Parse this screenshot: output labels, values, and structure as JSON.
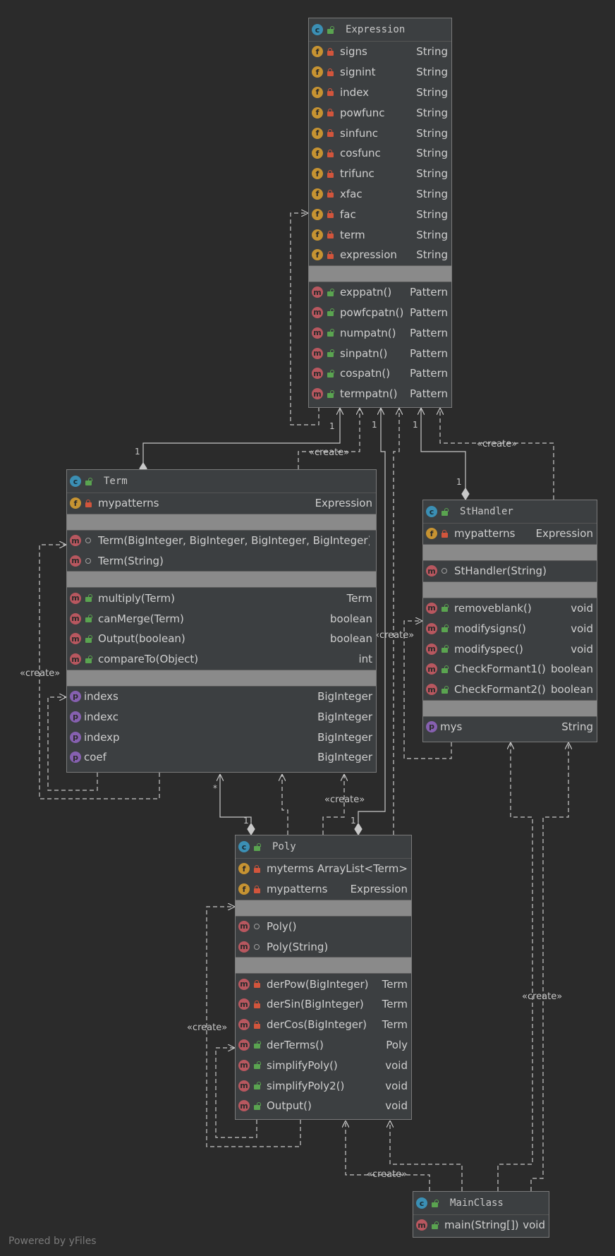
{
  "stereotype_create": "«create»",
  "footer": "Powered by yFiles",
  "multiplicity": {
    "one": "1",
    "many": "*"
  },
  "classes": {
    "expression": {
      "name": "Expression",
      "fields": [
        {
          "name": "signs",
          "type": "String"
        },
        {
          "name": "signint",
          "type": "String"
        },
        {
          "name": "index",
          "type": "String"
        },
        {
          "name": "powfunc",
          "type": "String"
        },
        {
          "name": "sinfunc",
          "type": "String"
        },
        {
          "name": "cosfunc",
          "type": "String"
        },
        {
          "name": "trifunc",
          "type": "String"
        },
        {
          "name": "xfac",
          "type": "String"
        },
        {
          "name": "fac",
          "type": "String"
        },
        {
          "name": "term",
          "type": "String"
        },
        {
          "name": "expression",
          "type": "String"
        }
      ],
      "methods": [
        {
          "name": "exppatn()",
          "type": "Pattern"
        },
        {
          "name": "powfcpatn()",
          "type": "Pattern"
        },
        {
          "name": "numpatn()",
          "type": "Pattern"
        },
        {
          "name": "sinpatn()",
          "type": "Pattern"
        },
        {
          "name": "cospatn()",
          "type": "Pattern"
        },
        {
          "name": "termpatn()",
          "type": "Pattern"
        }
      ]
    },
    "term": {
      "name": "Term",
      "fields": [
        {
          "name": "mypatterns",
          "type": "Expression"
        }
      ],
      "constructors": [
        {
          "name": "Term(BigInteger, BigInteger, BigInteger, BigInteger)",
          "type": ""
        },
        {
          "name": "Term(String)",
          "type": ""
        }
      ],
      "methods": [
        {
          "name": "multiply(Term)",
          "type": "Term"
        },
        {
          "name": "canMerge(Term)",
          "type": "boolean"
        },
        {
          "name": "Output(boolean)",
          "type": "boolean"
        },
        {
          "name": "compareTo(Object)",
          "type": "int"
        }
      ],
      "properties": [
        {
          "name": "indexs",
          "type": "BigInteger"
        },
        {
          "name": "indexc",
          "type": "BigInteger"
        },
        {
          "name": "indexp",
          "type": "BigInteger"
        },
        {
          "name": "coef",
          "type": "BigInteger"
        }
      ]
    },
    "sthandler": {
      "name": "StHandler",
      "fields": [
        {
          "name": "mypatterns",
          "type": "Expression"
        }
      ],
      "constructors": [
        {
          "name": "StHandler(String)",
          "type": ""
        }
      ],
      "methods": [
        {
          "name": "removeblank()",
          "type": "void"
        },
        {
          "name": "modifysigns()",
          "type": "void"
        },
        {
          "name": "modifyspec()",
          "type": "void"
        },
        {
          "name": "CheckFormant1()",
          "type": "boolean"
        },
        {
          "name": "CheckFormant2()",
          "type": "boolean"
        }
      ],
      "properties": [
        {
          "name": "mys",
          "type": "String"
        }
      ]
    },
    "poly": {
      "name": "Poly",
      "fields": [
        {
          "name": "myterms",
          "type": "ArrayList<Term>"
        },
        {
          "name": "mypatterns",
          "type": "Expression"
        }
      ],
      "constructors": [
        {
          "name": "Poly()",
          "type": ""
        },
        {
          "name": "Poly(String)",
          "type": ""
        }
      ],
      "methods": [
        {
          "name": "derPow(BigInteger)",
          "type": "Term"
        },
        {
          "name": "derSin(BigInteger)",
          "type": "Term"
        },
        {
          "name": "derCos(BigInteger)",
          "type": "Term"
        },
        {
          "name": "derTerms()",
          "type": "Poly"
        },
        {
          "name": "simplifyPoly()",
          "type": "void"
        },
        {
          "name": "simplifyPoly2()",
          "type": "void"
        },
        {
          "name": "Output()",
          "type": "void"
        }
      ]
    },
    "mainclass": {
      "name": "MainClass",
      "methods": [
        {
          "name": "main(String[])",
          "type": "void"
        }
      ]
    }
  }
}
